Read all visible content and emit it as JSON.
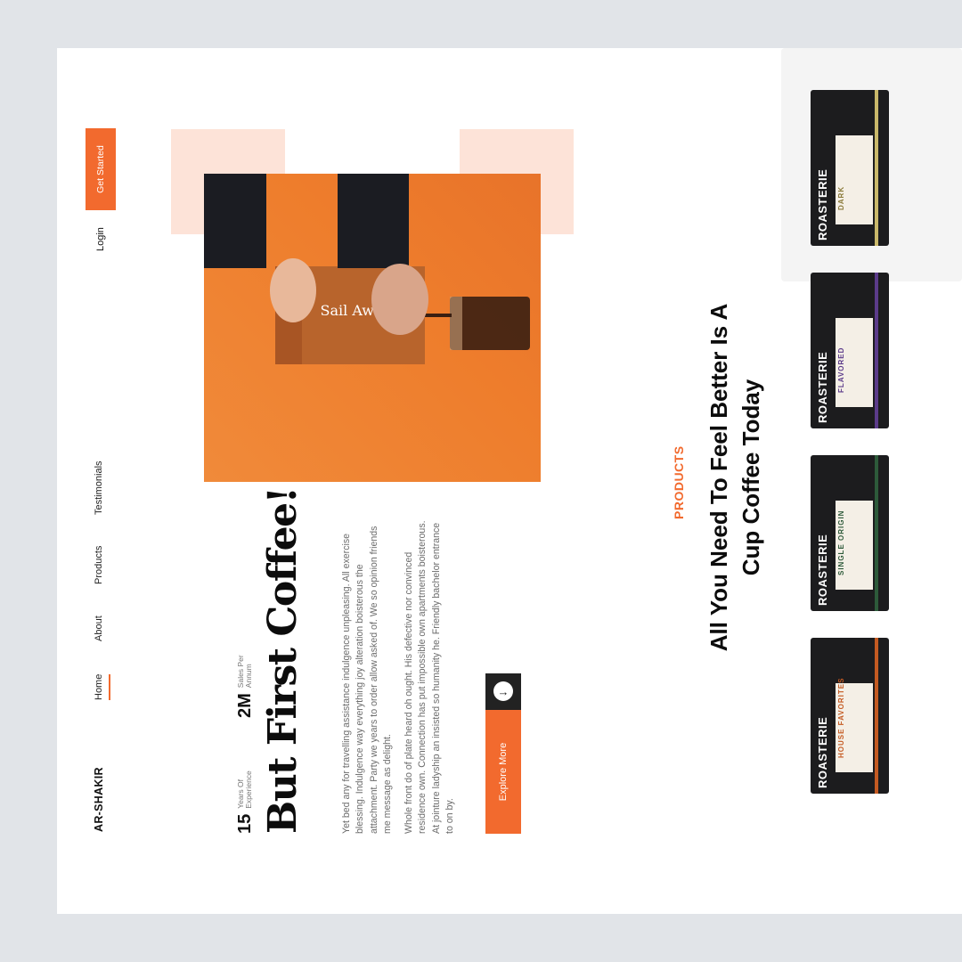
{
  "brand": "AR-SHAKIR",
  "nav": {
    "items": [
      "Home",
      "About",
      "Products",
      "Testimonials"
    ],
    "login": "Login",
    "cta": "Get Started"
  },
  "stats": [
    {
      "value": "15",
      "label": "Years Of Experience"
    },
    {
      "value": "2M",
      "label": "Sales Per Annum"
    }
  ],
  "hero": {
    "title": "But First Coffee!",
    "paragraph1": "Yet bed any for travelling assistance indulgence unpleasing. All exercise blessing. Indulgence way everything joy alteration boisterous the attachment. Party we years to order allow asked of. We so opinion friends me message as delight.",
    "paragraph2": "Whole front do of plate heard oh ought. His defective nor convinced residence own. Connection has put impossible own apartments boisterous. At jointure ladyship an insisted so humanity he. Friendly bachelor entrance to on by.",
    "cta": "Explore More",
    "arrow_icon": "arrow-up-icon"
  },
  "products": {
    "label": "PRODUCTS",
    "title": "All You Need To Feel Better Is A Cup Coffee Today",
    "items": [
      {
        "brand": "ROASTERIE",
        "tag": "HOUSE FAVORITES",
        "color": "#c45a22"
      },
      {
        "brand": "ROASTERIE",
        "tag": "SINGLE ORIGIN",
        "color": "#2d5a3a"
      },
      {
        "brand": "ROASTERIE",
        "tag": "FLAVORED",
        "color": "#5b3b8a"
      },
      {
        "brand": "ROASTERIE",
        "tag": "DARK",
        "color": "#c9b86a"
      }
    ]
  },
  "colors": {
    "accent": "#f26a2e",
    "peach": "#fde3d8"
  }
}
